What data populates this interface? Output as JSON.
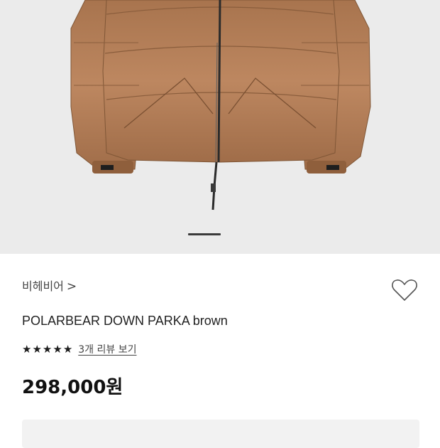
{
  "brand": {
    "name": "비헤비어",
    "chevron": ">"
  },
  "product": {
    "name": "POLARBEAR DOWN PARKA brown",
    "image_icon": "puffer-jacket-photo"
  },
  "rating": {
    "stars": 5,
    "star_glyph": "★",
    "review_label": "3개 리뷰 보기"
  },
  "price": {
    "amount": "298,000",
    "unit": "원"
  },
  "carousel": {
    "current": 1
  },
  "icons": {
    "wishlist": "heart-outline-icon"
  },
  "colors": {
    "image_bg": "#ebebeb",
    "jacket": "#b7825c",
    "accent": "#111111"
  }
}
